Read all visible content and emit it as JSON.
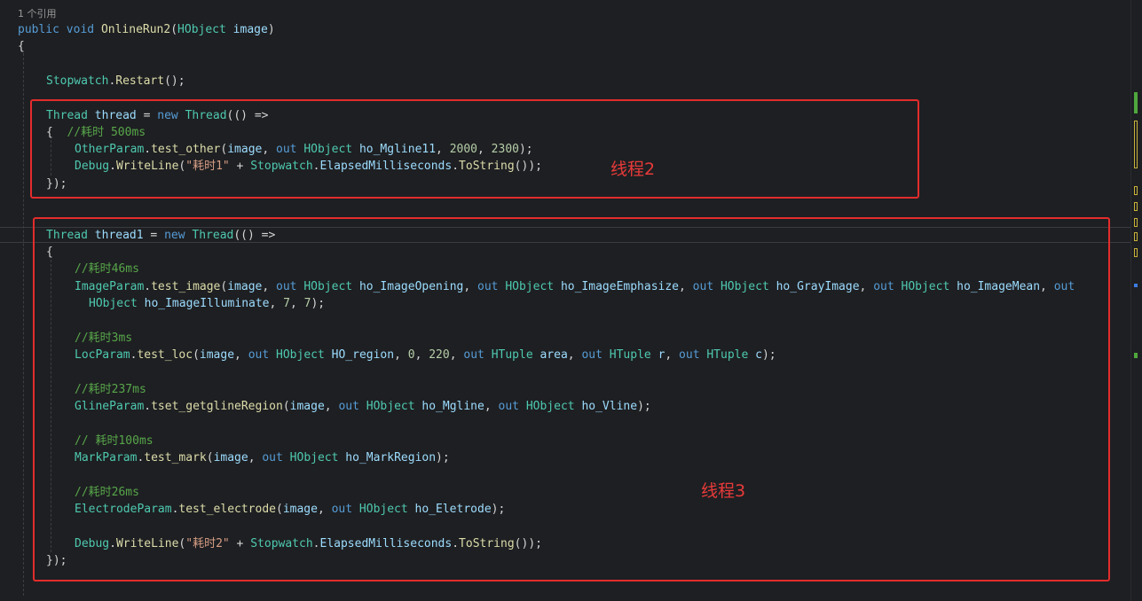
{
  "codelens": "1 个引用",
  "code": {
    "l1": {
      "public": "public",
      "void": "void",
      "method": "OnlineRun2",
      "type": "HObject",
      "param": "image"
    },
    "l2": "{",
    "l3": {
      "cls": "Stopwatch",
      "method": "Restart"
    },
    "l4": {
      "type": "Thread",
      "var": "thread",
      "new": "new",
      "ctor": "Thread",
      "arrow": "=>"
    },
    "l5": {
      "brace": "{",
      "comment": "//耗时 500ms"
    },
    "l6": {
      "cls": "OtherParam",
      "method": "test_other",
      "arg": "image",
      "out": "out",
      "type": "HObject",
      "var": "ho_Mgline11",
      "n1": "2000",
      "n2": "2300"
    },
    "l7": {
      "cls": "Debug",
      "method": "WriteLine",
      "str": "\"耗时1\"",
      "sw": "Stopwatch",
      "prop": "ElapsedMilliseconds",
      "tostr": "ToString"
    },
    "l8": "});",
    "l9": {
      "type": "Thread",
      "var": "thread1",
      "new": "new",
      "ctor": "Thread",
      "arrow": "=>"
    },
    "l10": "{",
    "l11": "//耗时46ms",
    "l12": {
      "cls": "ImageParam",
      "method": "test_image",
      "arg": "image",
      "out": "out",
      "type": "HObject",
      "v1": "ho_ImageOpening",
      "v2": "ho_ImageEmphasize",
      "v3": "ho_GrayImage",
      "v4": "ho_ImageMean"
    },
    "l13": {
      "type": "HObject",
      "v5": "ho_ImageIlluminate",
      "n1": "7",
      "n2": "7"
    },
    "l14": "//耗时3ms",
    "l15": {
      "cls": "LocParam",
      "method": "test_loc",
      "arg": "image",
      "out": "out",
      "type": "HObject",
      "v1": "HO_region",
      "n1": "0",
      "n2": "220",
      "ttype": "HTuple",
      "t1": "area",
      "t2": "r",
      "t3": "c"
    },
    "l16": "//耗时237ms",
    "l17": {
      "cls": "GlineParam",
      "method": "tset_getglineRegion",
      "arg": "image",
      "out": "out",
      "type": "HObject",
      "v1": "ho_Mgline",
      "v2": "ho_Vline"
    },
    "l18": "// 耗时100ms",
    "l19": {
      "cls": "MarkParam",
      "method": "test_mark",
      "arg": "image",
      "out": "out",
      "type": "HObject",
      "v1": "ho_MarkRegion"
    },
    "l20": "//耗时26ms",
    "l21": {
      "cls": "ElectrodeParam",
      "method": "test_electrode",
      "arg": "image",
      "out": "out",
      "type": "HObject",
      "v1": "ho_Eletrode"
    },
    "l22": {
      "cls": "Debug",
      "method": "WriteLine",
      "str": "\"耗时2\"",
      "sw": "Stopwatch",
      "prop": "ElapsedMilliseconds",
      "tostr": "ToString"
    },
    "l23": "});"
  },
  "annotations": {
    "thread2": "线程2",
    "thread3": "线程3"
  },
  "colors": {
    "background": "#1e1f22",
    "keyword": "#569cd6",
    "type": "#4ec9b0",
    "method": "#dcdcaa",
    "variable": "#9cdcfe",
    "number": "#b5cea8",
    "string": "#d69d85",
    "comment": "#57a64a",
    "annotation_red": "#e32c2c"
  }
}
